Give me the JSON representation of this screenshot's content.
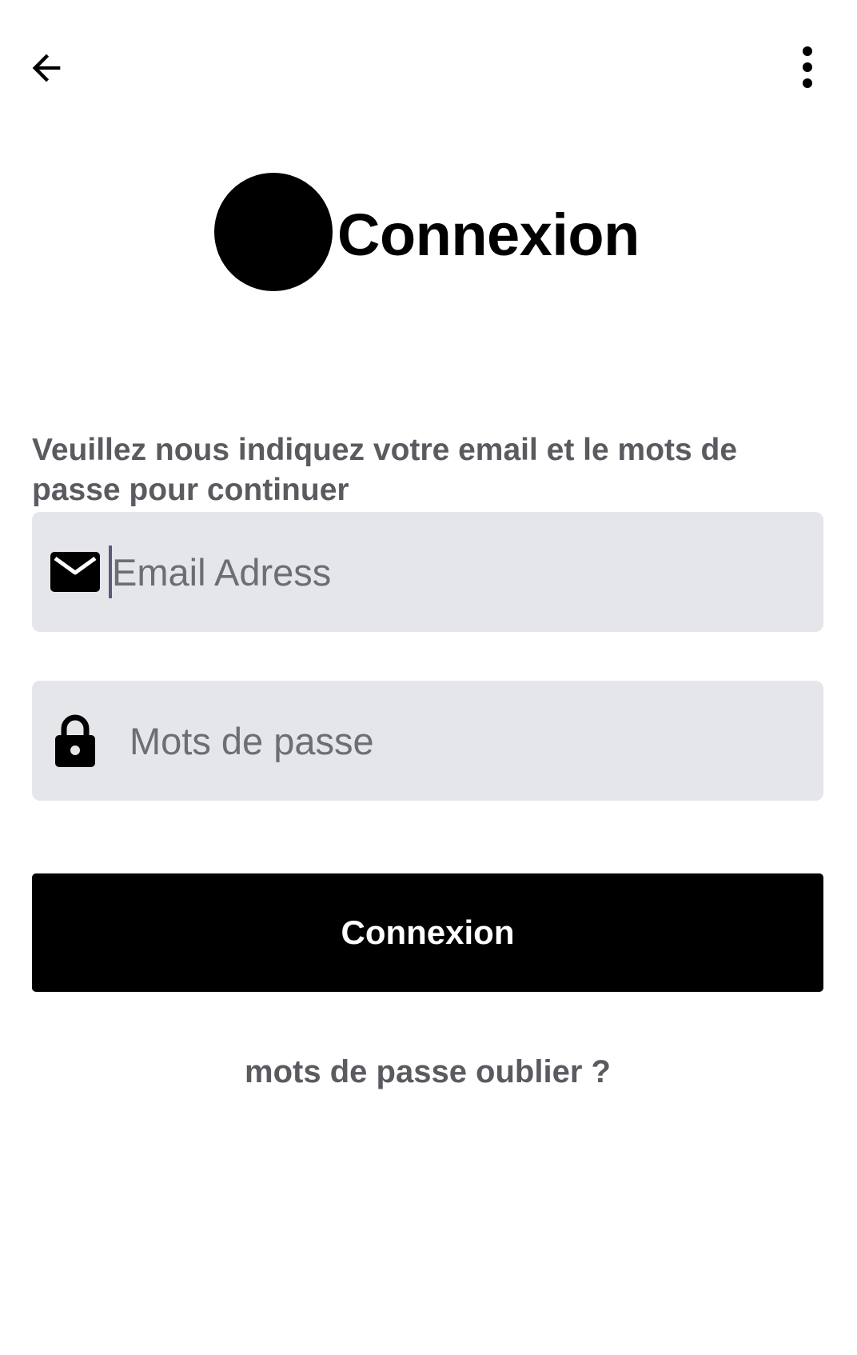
{
  "topbar": {
    "back_icon": "arrow-left-icon",
    "more_icon": "more-vertical-icon"
  },
  "brand": {
    "logo_icon": "circle-logo",
    "title": "Connexion"
  },
  "form": {
    "instructions": "Veuillez nous indiquez votre email et le mots de passe pour continuer",
    "email": {
      "icon": "mail-icon",
      "value": "",
      "placeholder": "Email Adress"
    },
    "password": {
      "icon": "lock-icon",
      "value": "",
      "placeholder": "Mots de passe"
    },
    "submit_label": "Connexion",
    "forgot_label": "mots de passe oublier ?"
  },
  "colors": {
    "background": "#ffffff",
    "field_bg": "#e5e6ea",
    "button_bg": "#000000",
    "muted_text": "#5a5b60"
  }
}
